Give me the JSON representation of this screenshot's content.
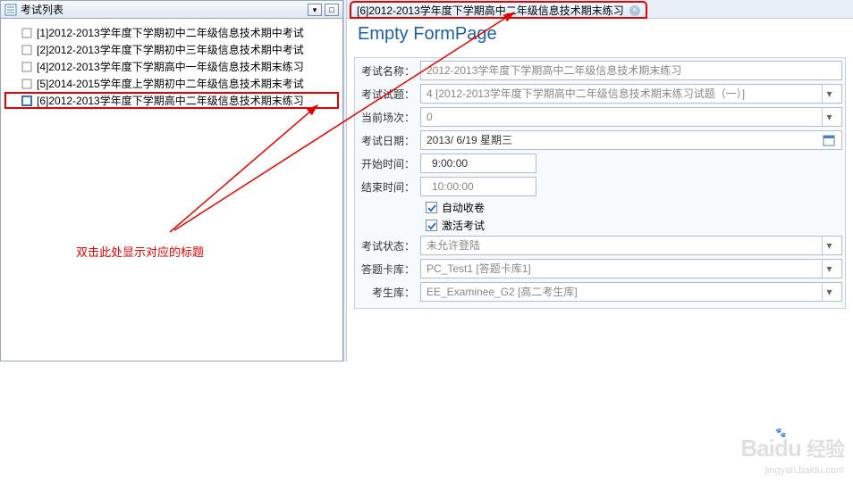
{
  "left": {
    "title": "考试列表",
    "items": [
      {
        "label": "[1]2012-2013学年度下学期初中二年级信息技术期中考试"
      },
      {
        "label": "[2]2012-2013学年度下学期初中三年级信息技术期中考试"
      },
      {
        "label": "[4]2012-2013学年度下学期高中一年级信息技术期末练习"
      },
      {
        "label": "[5]2014-2015学年度上学期初中二年级信息技术期末考试"
      },
      {
        "label": "[6]2012-2013学年度下学期高中二年级信息技术期末练习"
      }
    ],
    "hint": "双击此处显示对应的标题"
  },
  "tab": {
    "label": "[6]2012-2013学年度下学期高中二年级信息技术期末练习"
  },
  "page_title": "Empty FormPage",
  "form": {
    "name_label": "考试名称：",
    "name_value": "2012-2013学年度下学期高中二年级信息技术期末练习",
    "paper_label": "考试试题：",
    "paper_value": "4 [2012-2013学年度下学期高中二年级信息技术期末练习试题（一）]",
    "session_label": "当前场次：",
    "session_value": "0",
    "date_label": "考试日期：",
    "date_value": "2013/ 6/19 星期三",
    "start_label": "开始时间：",
    "start_value": "9:00:00",
    "end_label": "结束时间：",
    "end_value": "10:00:00",
    "chk1": "自动收卷",
    "chk2": "激活考试",
    "status_label": "考试状态：",
    "status_value": "未允许登陆",
    "cardlib_label": "答题卡库：",
    "cardlib_value": "PC_Test1 [答题卡库1]",
    "stulib_label": "考生库：",
    "stulib_value": "EE_Examinee_G2 [高二考生库]"
  },
  "watermark": {
    "brand_en": "Bai",
    "brand_du": "du",
    "brand_cn": "经验",
    "url": "jingyan.baidu.com"
  }
}
